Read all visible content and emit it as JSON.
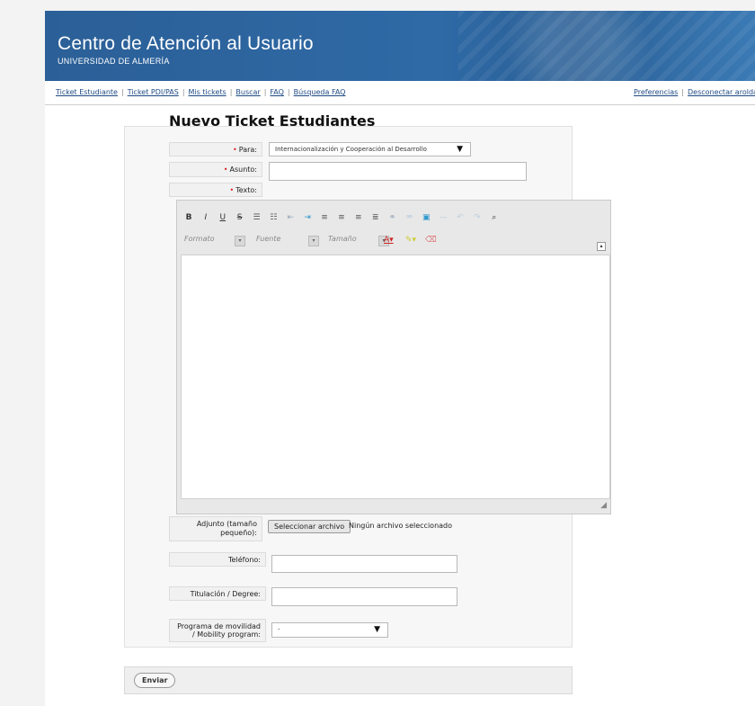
{
  "header": {
    "title": "Centro de Atención al Usuario",
    "subtitle": "UNIVERSIDAD DE ALMERÍA"
  },
  "nav": {
    "left": [
      "Ticket Estudiante",
      "Ticket PDI/PAS",
      "Mis tickets",
      "Buscar",
      "FAQ",
      "Búsqueda FAQ"
    ],
    "right": [
      "Preferencias",
      "Desconectar aroldan"
    ]
  },
  "page_title": "Nuevo Ticket Estudiantes",
  "form": {
    "para": {
      "label": "Para:",
      "value": "Internacionalización y Cooperación al Desarrollo"
    },
    "asunto": {
      "label": "Asunto:",
      "value": ""
    },
    "texto": {
      "label": "Texto:"
    },
    "toolbar": {
      "formato": "Formato",
      "fuente": "Fuente",
      "tamano": "Tamaño"
    },
    "adjunto": {
      "label": "Adjunto (tamaño pequeño):",
      "button": "Seleccionar archivo",
      "status": "Ningún archivo seleccionado"
    },
    "telefono": {
      "label": "Teléfono:",
      "value": ""
    },
    "titulacion": {
      "label": "Titulación / Degree:",
      "value": ""
    },
    "movilidad": {
      "label": "Programa de movilidad / Mobility program:",
      "value": "-"
    }
  },
  "submit": {
    "label": "Enviar"
  },
  "colors": {
    "banner": "#2f6aa6",
    "link": "#1f4b85",
    "required": "#dd2222"
  }
}
